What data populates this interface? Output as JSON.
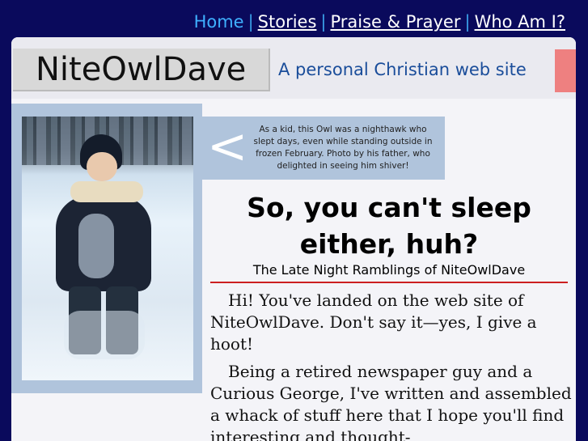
{
  "nav": {
    "items": [
      {
        "label": "Home"
      },
      {
        "label": "Stories"
      },
      {
        "label": "Praise & Prayer"
      },
      {
        "label": "Who Am I?"
      }
    ],
    "separator": "|"
  },
  "header": {
    "logo": "NiteOwlDave",
    "tagline": "A personal Christian web site"
  },
  "photo": {
    "caption_arrow": "<",
    "caption": "As a kid, this Owl was a nighthawk who slept days, even while standing outside in frozen February. Photo by his father, who delighted in seeing him shiver!"
  },
  "main": {
    "headline": "So, you can't sleep either, huh?",
    "subhead": "The Late Night Ramblings of NiteOwlDave",
    "paragraphs": [
      "Hi! You've landed on the web site of NiteOwlDave. Don't say it—yes, I give a hoot!",
      "Being a retired newspaper guy and a Curious George, I've written and assembled a whack of stuff here that I hope you'll find interesting and thought-"
    ]
  },
  "colors": {
    "background": "#0a0a5c",
    "nav_link": "#ffffff",
    "nav_current": "#3fb0ff",
    "tagline": "#1a4d9a",
    "accent_rule": "#cc2020",
    "frame": "#b0c4dc",
    "pink_block": "#ee8080"
  }
}
